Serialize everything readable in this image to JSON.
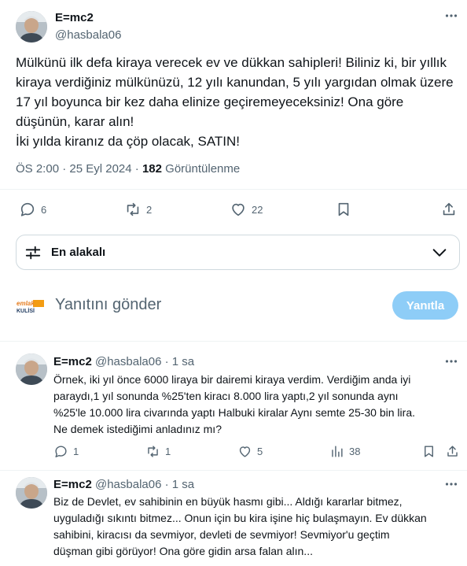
{
  "main_tweet": {
    "author_name": "E=mc2",
    "author_handle": "@hasbala06",
    "more_icon": "more-horizontal-icon",
    "body_lines": [
      "Mülkünü ilk defa kiraya verecek ev ve dükkan sahipleri! Biliniz ki, bir yıllık",
      "kiraya verdiğiniz mülkünüzü, 12 yılı kanundan, 5 yılı yargıdan olmak üzere",
      "17 yıl boyunca bir kez daha elinize geçiremeyeceksiniz! Ona göre",
      "düşünün, karar alın!",
      "İki yılda kiranız da çöp olacak, SATIN!"
    ],
    "time": "ÖS 2:00",
    "separator": "·",
    "date": "25 Eyl 2024",
    "views_count": "182",
    "views_label": "Görüntülenme",
    "actions": {
      "replies": "6",
      "retweets": "2",
      "likes": "22"
    }
  },
  "sort": {
    "label": "En alakalı",
    "icon": "sliders-icon",
    "chevron": "chevron-down-icon"
  },
  "compose": {
    "placeholder": "Yanıtını gönder",
    "button_label": "Yanıtla",
    "button_color": "#8ecdf7",
    "avatar_text_top": "emlak",
    "avatar_text_bottom": "KULİSİ"
  },
  "replies": [
    {
      "author_name": "E=mc2",
      "author_handle": "@hasbala06",
      "dot": "·",
      "time_ago": "1 sa",
      "body_lines": [
        "Örnek, iki yıl önce 6000  liraya bir dairemi kiraya verdim. Verdiğim anda iyi",
        "paraydı,1 yıl sonunda %25'ten kiracı 8.000 lira yaptı,2 yıl sonunda aynı",
        "%25'le 10.000 lira civarında yaptı Halbuki kiralar Aynı semte 25-30 bin lira.",
        "Ne demek istediğimi anladınız mı?"
      ],
      "actions": {
        "replies": "1",
        "retweets": "1",
        "likes": "5",
        "views": "38"
      }
    },
    {
      "author_name": "E=mc2",
      "author_handle": "@hasbala06",
      "dot": "·",
      "time_ago": "1 sa",
      "body_lines": [
        "Biz de Devlet, ev sahibinin en büyük hasmı gibi... Aldığı kararlar bitmez,",
        "uyguladığı sıkıntı bitmez... Onun için bu kira işine hiç bulaşmayın. Ev dükkan",
        "sahibini, kiracısı da sevmiyor, devleti de sevmiyor! Sevmiyor'u geçtim",
        "düşman gibi görüyor! Ona göre gidin arsa falan alın..."
      ]
    }
  ],
  "colors": {
    "accent": "#1d9bf0",
    "muted": "#536471",
    "text": "#0f1419",
    "border": "#cfd9de"
  }
}
